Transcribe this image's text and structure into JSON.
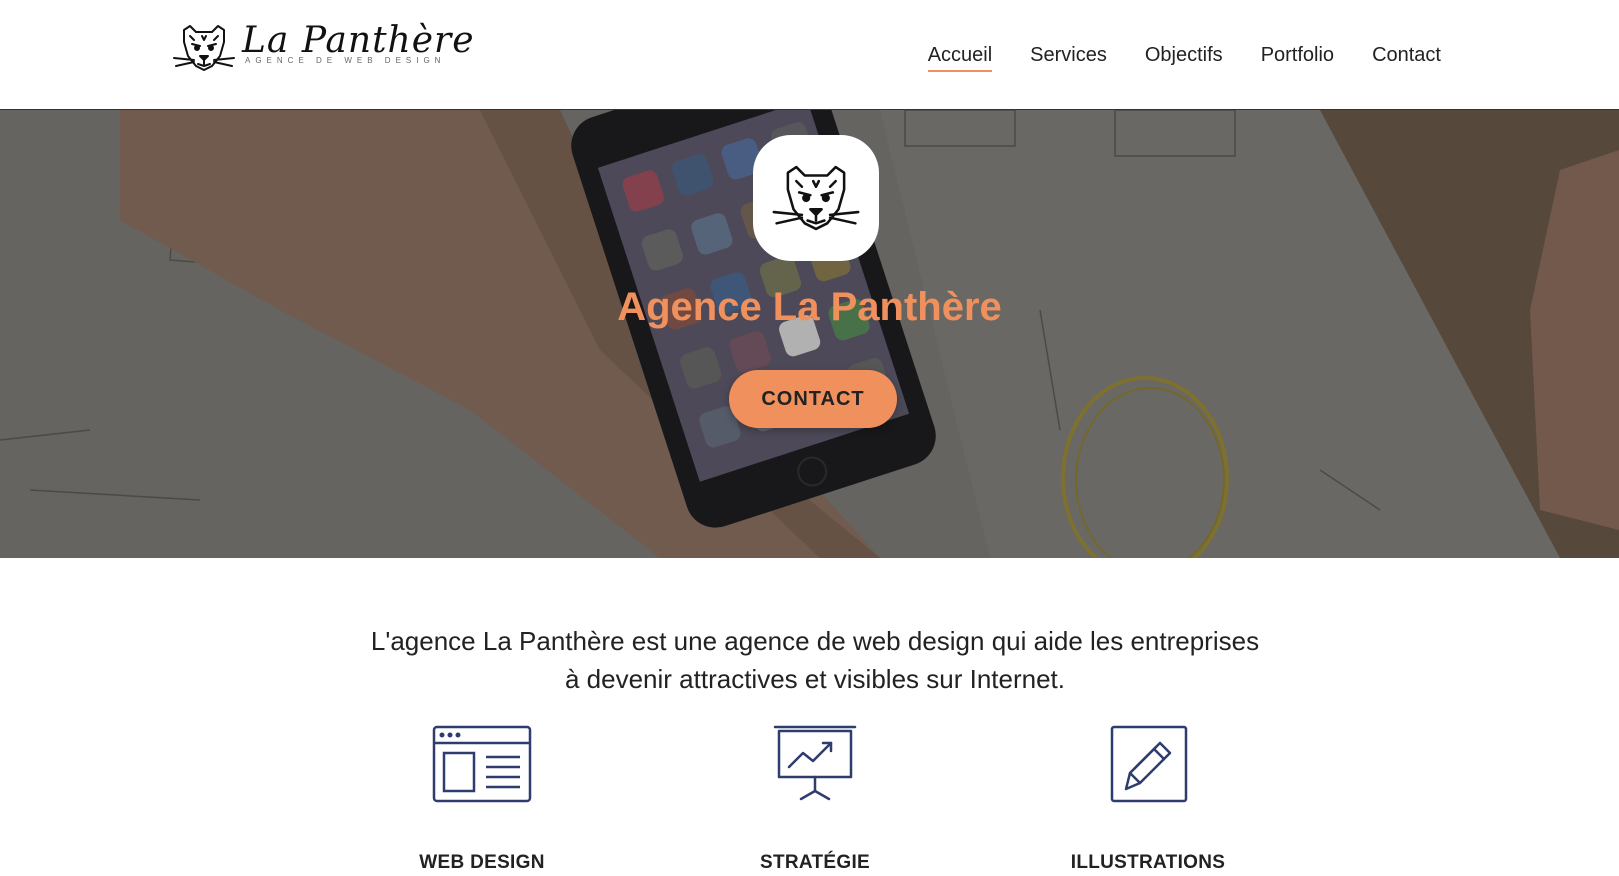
{
  "header": {
    "logo": {
      "title": "La Panthère",
      "tagline": "AGENCE DE WEB DESIGN",
      "icon": "panther-head-icon"
    },
    "nav": [
      {
        "label": "Accueil",
        "active": true
      },
      {
        "label": "Services",
        "active": false
      },
      {
        "label": "Objectifs",
        "active": false
      },
      {
        "label": "Portfolio",
        "active": false
      },
      {
        "label": "Contact",
        "active": false
      }
    ]
  },
  "hero": {
    "title": "Agence La Panthère",
    "button_label": "CONTACT",
    "icon": "panther-head-icon"
  },
  "intro": {
    "line1": "L'agence La Panthère est une agence de web design qui aide les entreprises",
    "line2": "à devenir attractives et visibles sur Internet."
  },
  "services": [
    {
      "label": "WEB DESIGN",
      "icon": "browser-window-icon"
    },
    {
      "label": "STRATÉGIE",
      "icon": "presentation-chart-icon"
    },
    {
      "label": "ILLUSTRATIONS",
      "icon": "pencil-square-icon"
    }
  ],
  "colors": {
    "accent": "#f0915d",
    "icon_stroke": "#2e3c6e",
    "text": "#222222"
  }
}
